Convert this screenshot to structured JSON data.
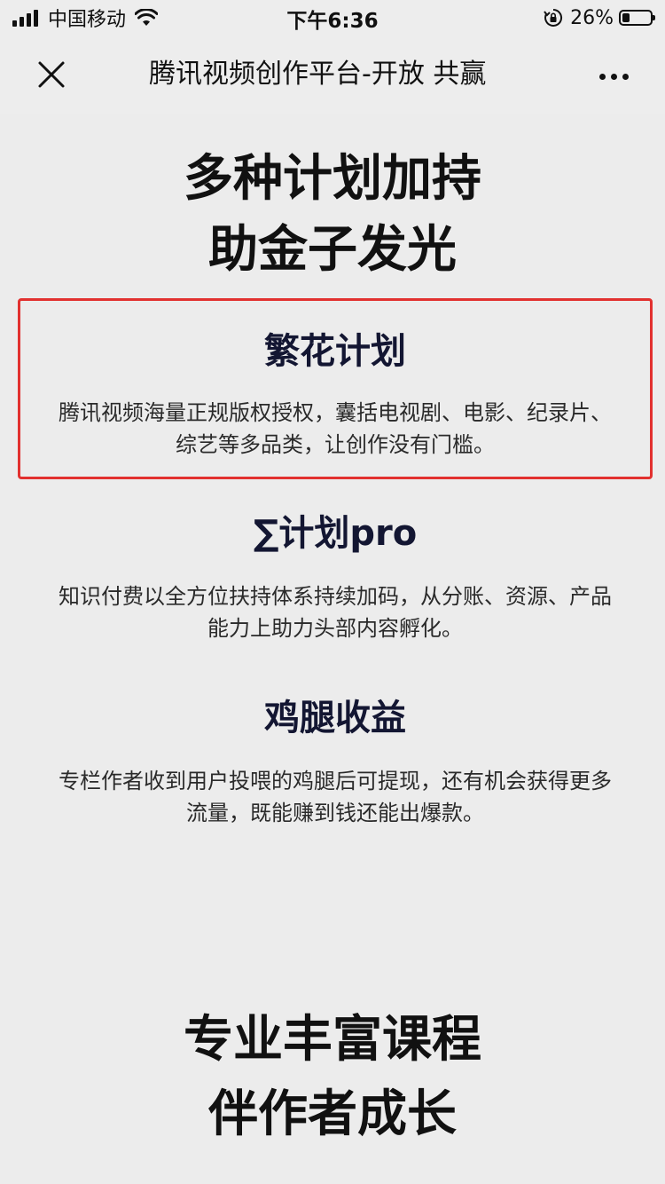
{
  "status_bar": {
    "carrier": "中国移动",
    "time": "下午6:36",
    "battery_percent": "26%",
    "battery_level": 0.26,
    "icons": [
      "signal-icon",
      "wifi-icon",
      "rotation-lock-icon",
      "battery-icon"
    ]
  },
  "nav": {
    "title": "腾讯视频创作平台-开放 共赢",
    "close_icon": "close-icon",
    "more_icon": "more-icon"
  },
  "hero": {
    "line1": "多种计划加持",
    "line2": "助金子发光"
  },
  "plans": [
    {
      "title": "繁花计划",
      "desc_line1": "腾讯视频海量正规版权授权，囊括电视剧、电影、纪录片、",
      "desc_line2": "综艺等多品类，让创作没有门槛。",
      "highlighted": true
    },
    {
      "title": "∑计划pro",
      "desc_line1": "知识付费以全方位扶持体系持续加码，从分账、资源、产品",
      "desc_line2": "能力上助力头部内容孵化。",
      "highlighted": false
    },
    {
      "title": "鸡腿收益",
      "desc_line1": "专栏作者收到用户投喂的鸡腿后可提现，还有机会获得更多",
      "desc_line2": "流量，既能赚到钱还能出爆款。",
      "highlighted": false
    }
  ],
  "courses": {
    "line1": "专业丰富课程",
    "line2": "伴作者成长"
  },
  "colors": {
    "background": "#ececec",
    "highlight_border": "#e2312f",
    "plan_title": "#131632"
  }
}
